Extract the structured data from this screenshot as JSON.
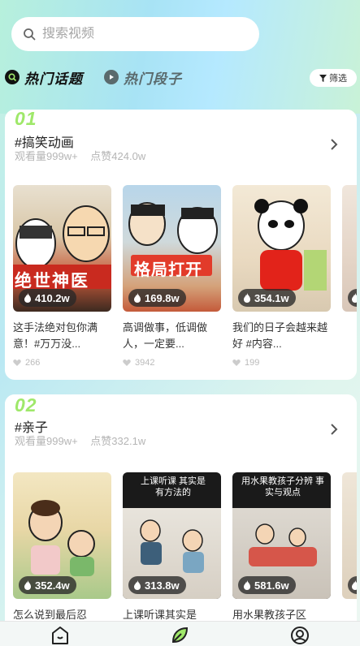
{
  "search": {
    "placeholder": "搜索视频"
  },
  "tabs": [
    {
      "label": "热门话题",
      "active": true
    },
    {
      "label": "热门段子",
      "active": false
    }
  ],
  "filter": {
    "label": "筛选"
  },
  "topics": [
    {
      "rank": "01",
      "title": "#搞笑动画",
      "views": "观看量999w+",
      "likes": "点赞424.0w",
      "videos": [
        {
          "views": "410.2w",
          "title": "这手法绝对包你满意！#万万没...",
          "likes": "266",
          "thumb_label": "绝世神医"
        },
        {
          "views": "169.8w",
          "title": "高调做事，低调做人，一定要...",
          "likes": "3942",
          "thumb_label": "格局打开"
        },
        {
          "views": "354.1w",
          "title": "我们的日子会越来越好 #内容...",
          "likes": "199",
          "thumb_label": ""
        },
        {
          "views": "",
          "title": "",
          "likes": "",
          "thumb_label": ""
        }
      ]
    },
    {
      "rank": "02",
      "title": "#亲子",
      "views": "观看量999w+",
      "likes": "点赞332.1w",
      "videos": [
        {
          "views": "352.4w",
          "title": "怎么说到最后忍",
          "likes": "",
          "thumb_label": ""
        },
        {
          "views": "313.8w",
          "title": "上课听课其实是",
          "likes": "",
          "thumb_label": "上课听课 其实是有方法的"
        },
        {
          "views": "581.6w",
          "title": "用水果教孩子区",
          "likes": "",
          "thumb_label": "用水果教孩子分辨 事实与观点"
        },
        {
          "views": "",
          "title": "",
          "likes": "",
          "thumb_label": ""
        }
      ]
    }
  ],
  "colors": {
    "accent": "#9fe86a",
    "dark": "#111111"
  }
}
